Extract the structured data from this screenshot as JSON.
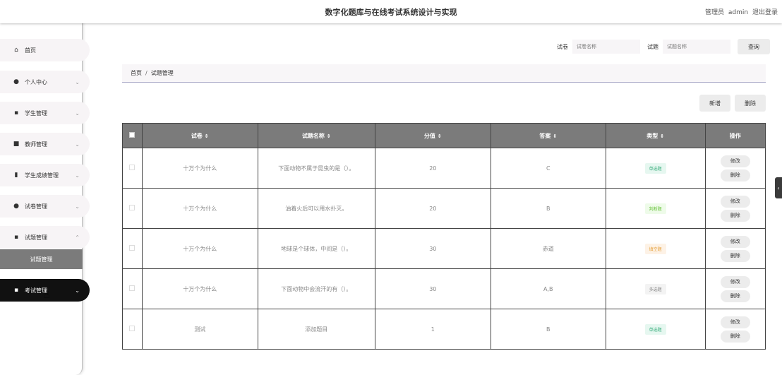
{
  "header": {
    "title": "数字化题库与在线考试系统设计与实现",
    "user_role": "管理员",
    "username": "admin",
    "logout": "退出登录"
  },
  "sidebar": {
    "items": [
      {
        "label": "首页",
        "icon": "home-icon",
        "glyph": "⌂"
      },
      {
        "label": "个人中心",
        "icon": "user-icon",
        "glyph": "●",
        "arrow": "⌄"
      },
      {
        "label": "学生管理",
        "icon": "grid-icon",
        "glyph": "▪",
        "arrow": "⌄"
      },
      {
        "label": "教师管理",
        "icon": "id-card-icon",
        "glyph": "■",
        "arrow": "⌄"
      },
      {
        "label": "学生成绩管理",
        "icon": "clipboard-icon",
        "glyph": "▮",
        "arrow": "⌄"
      },
      {
        "label": "试卷管理",
        "icon": "user-icon",
        "glyph": "●",
        "arrow": "⌄"
      },
      {
        "label": "试题管理",
        "icon": "grid-icon",
        "glyph": "▪",
        "arrow": "⌃"
      },
      {
        "label": "考试管理",
        "icon": "grid-icon",
        "glyph": "▪",
        "arrow": "⌄"
      }
    ],
    "submenu_label": "试题管理"
  },
  "search": {
    "paper_label": "试卷",
    "paper_placeholder": "试卷名称",
    "question_label": "试题",
    "question_placeholder": "试题名称",
    "button": "查询"
  },
  "breadcrumb": {
    "home": "首页",
    "separator": "/",
    "current": "试题管理"
  },
  "actions": {
    "add": "新增",
    "delete": "删除"
  },
  "table": {
    "columns": [
      "试卷",
      "试题名称",
      "分值",
      "答案",
      "类型",
      "操作"
    ],
    "sort_glyph": "⇕",
    "rows": [
      {
        "paper": "十万个为什么",
        "question": "下面动物不属于昆虫的是（）。",
        "score": "20",
        "answer": "C",
        "type": "单选题"
      },
      {
        "paper": "十万个为什么",
        "question": "油着火后可以用水扑灭。",
        "score": "20",
        "answer": "B",
        "type": "判断题"
      },
      {
        "paper": "十万个为什么",
        "question": "地球是个球体，中间是（）。",
        "score": "30",
        "answer": "赤道",
        "type": "填空题"
      },
      {
        "paper": "十万个为什么",
        "question": "下面动物中会流汗的有（）。",
        "score": "30",
        "answer": "A,B",
        "type": "多选题"
      },
      {
        "paper": "测试",
        "question": "添加题目",
        "score": "1",
        "answer": "B",
        "type": "单选题"
      }
    ],
    "edit_label": "修改",
    "delete_label": "删除"
  },
  "colors": {
    "single": {
      "bg": "#e6f7f0",
      "fg": "#3aae7d"
    },
    "judge": {
      "bg": "#eefbe9",
      "fg": "#67c23a"
    },
    "fill": {
      "bg": "#fdf2e6",
      "fg": "#e6a23c"
    },
    "multi": {
      "bg": "#f3f3f3",
      "fg": "#888888"
    }
  },
  "side_tab": "‹"
}
